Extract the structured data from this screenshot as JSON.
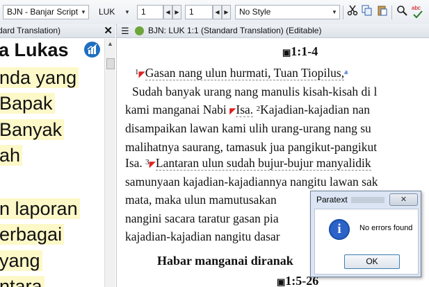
{
  "toolbar": {
    "project": "BJN - Banjar Script",
    "book": "LUK",
    "chapter": "1",
    "verse": "1",
    "style": "No Style",
    "icons": [
      "cut-icon",
      "copy-icon",
      "paste-icon",
      "search-icon",
      "spellcheck-icon"
    ],
    "spellcheck_glyph": "abc"
  },
  "left_pane": {
    "title": "dard Translation)",
    "close_glyph": "✕",
    "text_lines": [
      "a Lukas",
      "nda yang",
      "Bapak",
      "Banyak",
      "ah",
      "n laporan",
      "erbagai",
      "yang",
      "ntara"
    ]
  },
  "main_pane": {
    "title": "BJN: LUK 1:1 (Standard Translation) (Editable)",
    "section_ref": "1:1-4",
    "lines": [
      {
        "parts": [
          "1",
          "Gasan nang ulun hurmati, Tuan Tiopilus,",
          "a"
        ]
      },
      {
        "text": "Sudah banyak urang nang manulis kisah-kisah di l"
      },
      {
        "parts": [
          "kami manganai Nabi ",
          "Isa.",
          " ",
          "2",
          "Kajadian-kajadian nan"
        ]
      },
      {
        "text": "disampaikan lawan kami ulih urang-urang nang su"
      },
      {
        "text": "malihatnya saurang, tamasuk jua pangikut-pangikut"
      },
      {
        "parts": [
          "Isa. ",
          "3",
          "Lantaran ulun sudah bujur-bujur manyalidik"
        ]
      },
      {
        "text": "samunyaan kajadian-kajadiannya nangitu lawan sak"
      },
      {
        "text": "mata, maka ulun mamutusakan"
      },
      {
        "text": "nangini sacara taratur gasan pia"
      },
      {
        "text": "kajadian-kajadian nangitu dasar"
      }
    ],
    "section_heading": "Habar manganai diranak",
    "next_ref": "1:5-26"
  },
  "dialog": {
    "title": "Paratext",
    "close_glyph": "✕",
    "message": "No errors found",
    "ok_label": "OK",
    "info_glyph": "i"
  },
  "colors": {
    "highlight": "#fdf8c8",
    "info": "#2b63c9",
    "flag": "#dd2222",
    "footnote": "#2d63c8"
  }
}
